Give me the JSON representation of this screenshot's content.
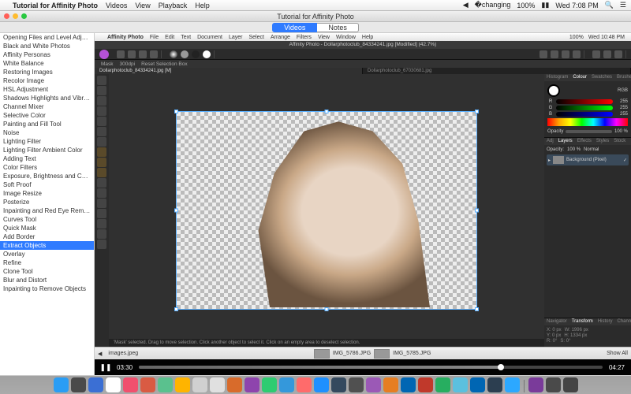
{
  "outer_menu": {
    "app_name": "Tutorial for Affinity Photo",
    "items": [
      "Videos",
      "View",
      "Playback",
      "Help"
    ],
    "battery": "100%",
    "clock": "Wed 7:08 PM"
  },
  "window": {
    "title": "Tutorial for Affinity Photo",
    "tabs": {
      "videos": "Videos",
      "notes": "Notes"
    }
  },
  "sidebar_items": [
    "Opening Files and Level Adjustment",
    "Black and White Photos",
    "Affinity Personas",
    "White Balance",
    "Restoring Images",
    "Recolor Image",
    "HSL Adjustment",
    "Shadows Highlights and Vibrance",
    "Channel Mixer",
    "Selective Color",
    "Painting and Fill Tool",
    "Noise",
    "Lighting Filter",
    "Lighting Filter Ambient Color",
    "Adding Text",
    "Color Filters",
    "Exposure, Brightness and Contrast",
    "Soft Proof",
    "Image Resize",
    "Posterize",
    "Inpainting and Red Eye Removal",
    "Curves Tool",
    "Quick Mask",
    "Add Border",
    "Extract Objects",
    "Overlay",
    "Refine",
    "Clone Tool",
    "Blur and Distort",
    "Inpainting to Remove Objects"
  ],
  "sidebar_selected_index": 24,
  "inner_app": {
    "name": "Affinity Photo",
    "menus": [
      "File",
      "Edit",
      "Text",
      "Document",
      "Layer",
      "Select",
      "Arrange",
      "Filters",
      "View",
      "Window",
      "Help"
    ],
    "battery": "100%",
    "clock": "Wed 10:48 PM",
    "doc_title": "Affinity Photo - Dollarphotoclub_84334241.jpg [Modified] (42.7%)",
    "opt_mask": "Mask",
    "opt_dpi": "300dpi",
    "opt_reset": "Reset Selection Box",
    "tabs": [
      "Dollarphotoclub_84334241.jpg [M]",
      "Dollarphotoclub_67030681.jpg"
    ],
    "hint": "'Mask' selected. Drag to move selection. Click another object to select it. Click on an empty area to deselect selection.",
    "panel_tabs_top": [
      "Histogram",
      "Colour",
      "Swatches",
      "Brushes"
    ],
    "rgb_label": "RGB",
    "rgb": {
      "r": 255,
      "g": 255,
      "b": 255
    },
    "opacity_label": "Opacity",
    "opacity_value": "100 %",
    "panel_tabs_mid": [
      "Adj",
      "Layers",
      "Effects",
      "Styles",
      "Stock"
    ],
    "layers_opacity_label": "Opacity:",
    "layers_opacity": "100 %",
    "blend_label": "Normal",
    "layer_name": "Background (Pixel)",
    "panel_tabs_bottom": [
      "Navigator",
      "Transform",
      "History",
      "Channels"
    ],
    "transform": {
      "x": "X: 0 px",
      "w": "W: 1996 px",
      "y": "Y: 0 px",
      "h": "H: 1334 px",
      "r": "R: 0°",
      "s": "S: 0°"
    }
  },
  "thumb_strip": {
    "first": "images.jpeg",
    "f1": "IMG_5786.JPG",
    "f2": "IMG_5785.JPG",
    "show_all": "Show All"
  },
  "player": {
    "current": "03:30",
    "total": "04:27"
  },
  "dock_colors": [
    "#2a9df4",
    "#4a4a4a",
    "#3b6fd4",
    "#ffffff",
    "#f0506e",
    "#d95b43",
    "#5ac18e",
    "#ffb400",
    "#d0d0d0",
    "#e0e0e0",
    "#d86b2b",
    "#8e44ad",
    "#2ecc71",
    "#3498db",
    "#ff6b6b",
    "#1e90ff",
    "#34495e",
    "#505050",
    "#9b59b6",
    "#e67e22",
    "#0066b3",
    "#c0392b",
    "#27ae60",
    "#5bc0de",
    "#0066b3",
    "#2c3e50",
    "#2ca8ff",
    "#7a3b9a",
    "#4a4a4a",
    "#444"
  ]
}
